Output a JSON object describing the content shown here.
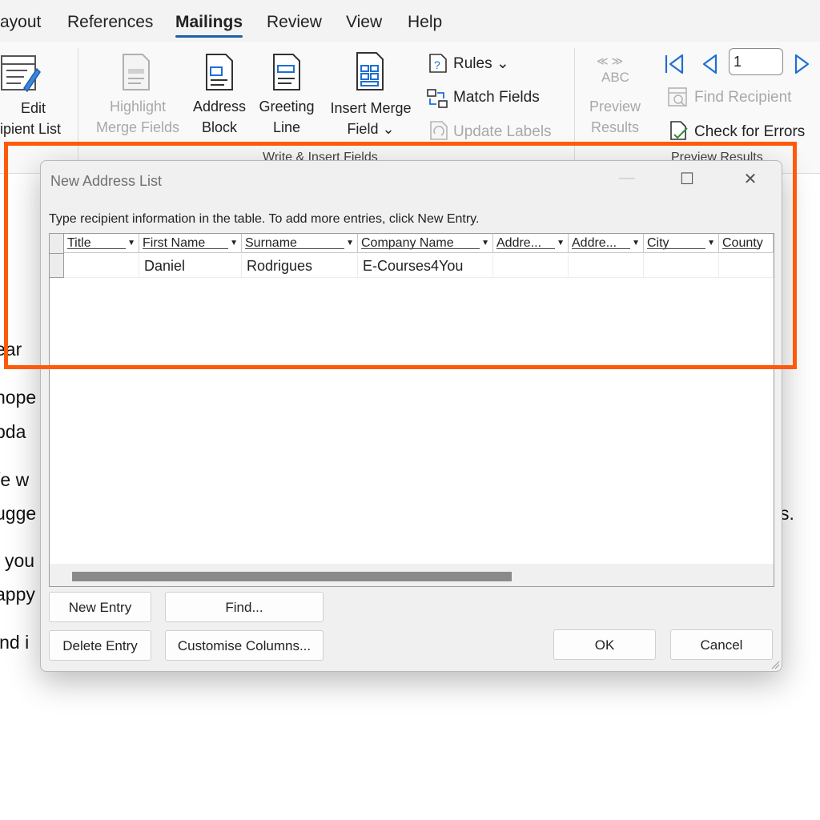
{
  "ribbon_tabs": [
    "ayout",
    "References",
    "Mailings",
    "Review",
    "View",
    "Help"
  ],
  "ribbon": {
    "edit_recipient": [
      "Edit",
      "ipient List"
    ],
    "highlight_merge_fields": [
      "Highlight",
      "Merge Fields"
    ],
    "address_block": [
      "Address",
      "Block"
    ],
    "greeting_line": [
      "Greeting",
      "Line"
    ],
    "insert_merge_field": [
      "Insert Merge",
      "Field ⌄"
    ],
    "rules": "Rules ⌄",
    "match_fields": "Match Fields",
    "update_labels": "Update Labels",
    "group_write_insert": "Write & Insert Fields",
    "abc_arrows": "≪ ≫",
    "abc": "ABC",
    "preview_results": [
      "Preview",
      "Results"
    ],
    "record_number": "1",
    "find_recipient": "Find Recipient",
    "check_for_errors": "Check for Errors",
    "group_preview": "Preview Results"
  },
  "document_fragments": [
    "ear",
    "hope",
    "pda",
    "/e w",
    "ugge",
    "s.",
    "you",
    "appy",
    "ind i"
  ],
  "dialog": {
    "title": "New Address List",
    "minimize": "—",
    "maximize": "☐",
    "close": "✕",
    "instruction": "Type recipient information in the table.  To add more entries, click New Entry.",
    "columns": [
      "Title",
      "First Name",
      "Surname",
      "Company Name",
      "Addre...",
      "Addre...",
      "City",
      "County"
    ],
    "rows": [
      [
        "",
        "Daniel",
        "Rodrigues",
        "E-Courses4You",
        "",
        "",
        "",
        ""
      ]
    ],
    "buttons": {
      "new_entry": "New Entry",
      "find": "Find...",
      "delete_entry": "Delete Entry",
      "customise_columns": "Customise Columns...",
      "ok": "OK",
      "cancel": "Cancel"
    }
  },
  "colors": {
    "highlight_box": "#ff5a0a",
    "accent": "#1f5fa8"
  }
}
